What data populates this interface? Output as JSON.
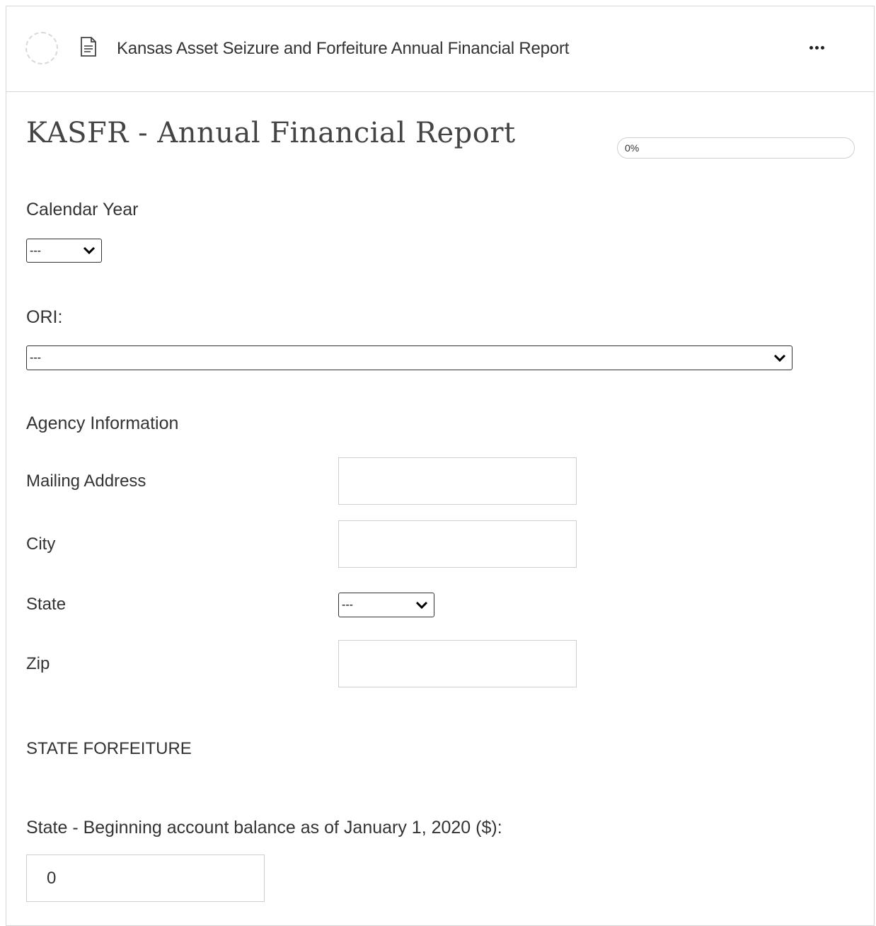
{
  "header": {
    "title": "Kansas Asset Seizure and Forfeiture Annual Financial Report",
    "more_icon": "more-horizontal-icon",
    "doc_icon": "document-icon"
  },
  "form": {
    "title": "KASFR - Annual Financial Report",
    "progress": {
      "text": "0%",
      "value": 0
    },
    "calendar_year": {
      "label": "Calendar Year",
      "selected": "---"
    },
    "ori": {
      "label": "ORI:",
      "selected": "---"
    },
    "agency_section": "Agency Information",
    "mailing_address": {
      "label": "Mailing Address",
      "value": ""
    },
    "city": {
      "label": "City",
      "value": ""
    },
    "state": {
      "label": "State",
      "selected": "---"
    },
    "zip": {
      "label": "Zip",
      "value": ""
    },
    "state_forfeiture_section": "STATE FORFEITURE",
    "beginning_balance": {
      "label": "State - Beginning account balance as of January 1, 2020 ($):",
      "value": "0"
    }
  }
}
